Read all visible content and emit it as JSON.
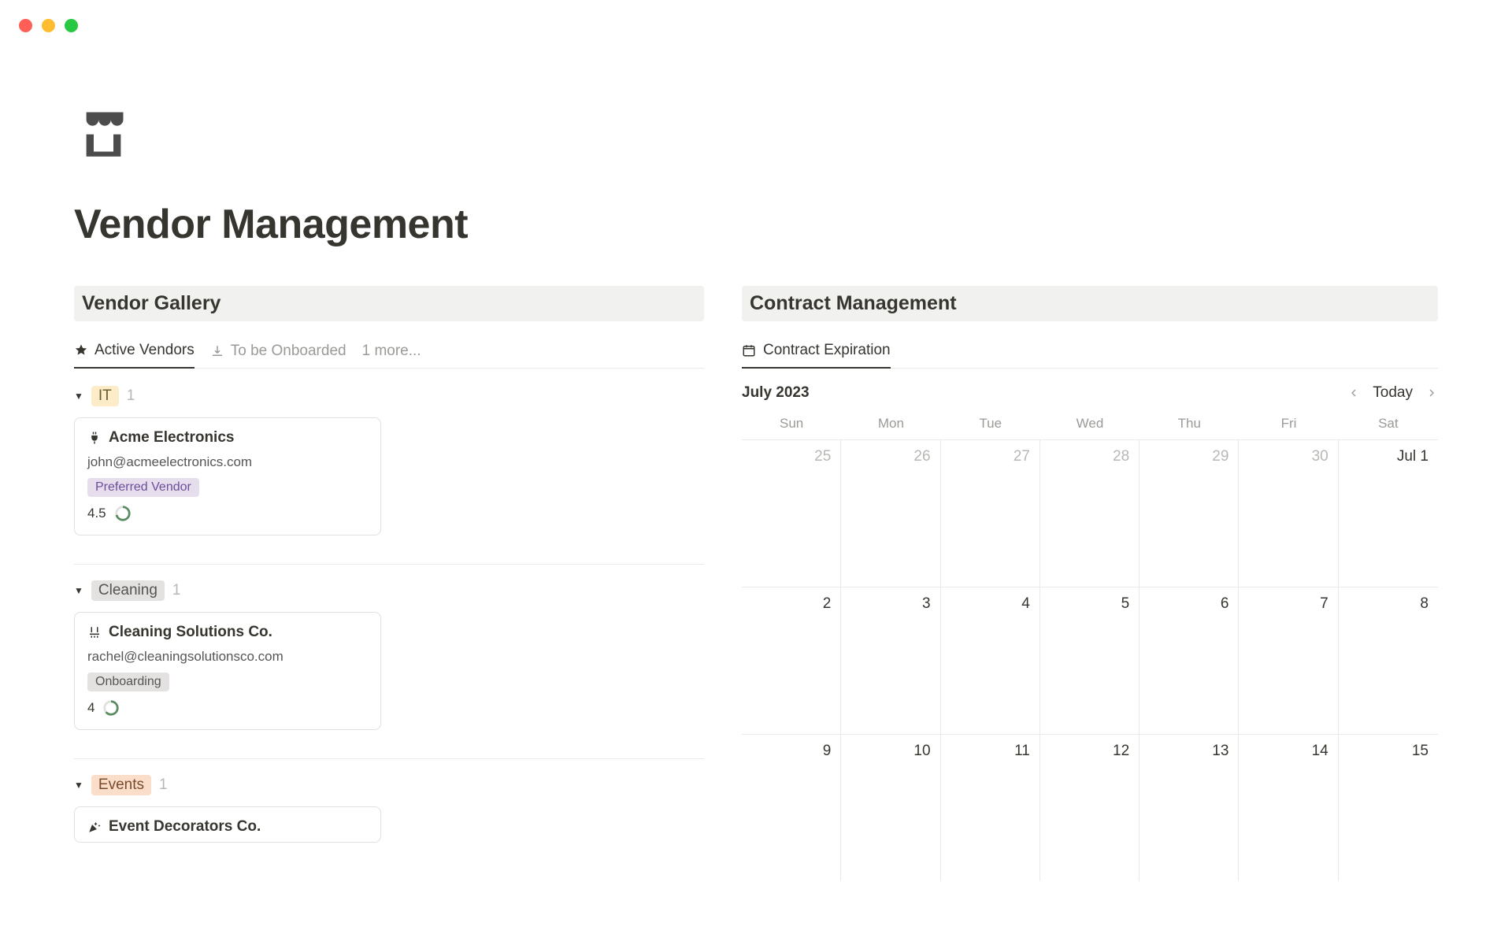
{
  "page": {
    "title": "Vendor Management"
  },
  "gallery": {
    "heading": "Vendor Gallery",
    "tabs": {
      "active_vendors": "Active Vendors",
      "to_be_onboarded": "To be Onboarded",
      "more": "1 more..."
    },
    "groups": [
      {
        "label": "IT",
        "count": "1",
        "chip_class": "it"
      },
      {
        "label": "Cleaning",
        "count": "1",
        "chip_class": "cleaning"
      },
      {
        "label": "Events",
        "count": "1",
        "chip_class": "events"
      }
    ],
    "cards": {
      "acme": {
        "title": "Acme Electronics",
        "email": "john@acmeelectronics.com",
        "status": "Preferred Vendor",
        "rating": "4.5"
      },
      "cleaning": {
        "title": "Cleaning Solutions Co.",
        "email": "rachel@cleaningsolutionsco.com",
        "status": "Onboarding",
        "rating": "4"
      },
      "events": {
        "title": "Event Decorators Co."
      }
    }
  },
  "contracts": {
    "heading": "Contract Management",
    "tab": "Contract Expiration",
    "month_label": "July 2023",
    "today_label": "Today",
    "day_headers": [
      "Sun",
      "Mon",
      "Tue",
      "Wed",
      "Thu",
      "Fri",
      "Sat"
    ],
    "week1": [
      "25",
      "26",
      "27",
      "28",
      "29",
      "30",
      "Jul 1"
    ],
    "week2": [
      "2",
      "3",
      "4",
      "5",
      "6",
      "7",
      "8"
    ],
    "week3": [
      "9",
      "10",
      "11",
      "12",
      "13",
      "14",
      "15"
    ]
  }
}
